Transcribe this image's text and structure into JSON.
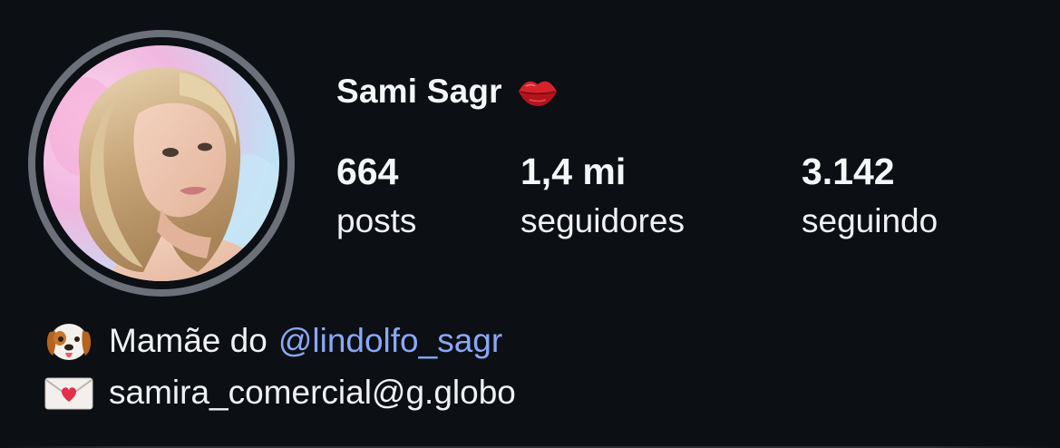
{
  "profile": {
    "username": "Sami Sagr",
    "username_emoji": "lips-icon",
    "avatar": "profile-photo"
  },
  "stats": {
    "posts": {
      "value": "664",
      "label": "posts"
    },
    "followers": {
      "value": "1,4 mi",
      "label": "seguidores"
    },
    "following": {
      "value": "3.142",
      "label": "seguindo"
    }
  },
  "bio": {
    "line1": {
      "icon": "dog-face-icon",
      "text": "Mamãe do",
      "mention": "@lindolfo_sagr"
    },
    "line2": {
      "icon": "love-letter-icon",
      "text": "samira_comercial@g.globo"
    }
  },
  "colors": {
    "background": "#0c0f14",
    "text": "#f5f6f7",
    "mention": "#8aa8f5",
    "avatar_ring": "#6b7079"
  }
}
